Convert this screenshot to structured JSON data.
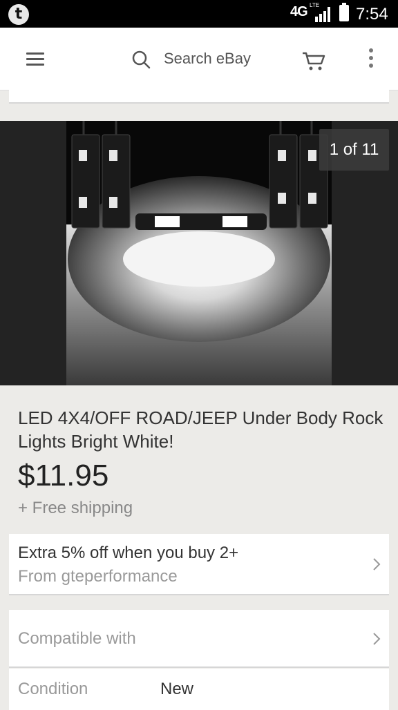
{
  "status_bar": {
    "app_icon_letter": "t",
    "network": "4G",
    "network_sub": "LTE",
    "time": "7:54"
  },
  "app_bar": {
    "search_placeholder": "Search eBay",
    "icons": [
      "menu-icon",
      "search-icon",
      "cart-icon",
      "more-vertical-icon"
    ]
  },
  "gallery": {
    "counter": "1 of 11",
    "image_content": "led-rock-light-modules"
  },
  "listing": {
    "title": "LED 4X4/OFF ROAD/JEEP Under Body Rock Lights Bright White!",
    "price": "$11.95",
    "shipping": "+ Free shipping"
  },
  "promo": {
    "offer": "Extra 5% off when you buy 2+",
    "seller": "From gteperformance"
  },
  "compatibility": {
    "label": "Compatible with"
  },
  "condition": {
    "label": "Condition",
    "value": "New"
  },
  "colors": {
    "background": "#ecebe8",
    "statusbar": "#000000",
    "card": "#ffffff"
  }
}
